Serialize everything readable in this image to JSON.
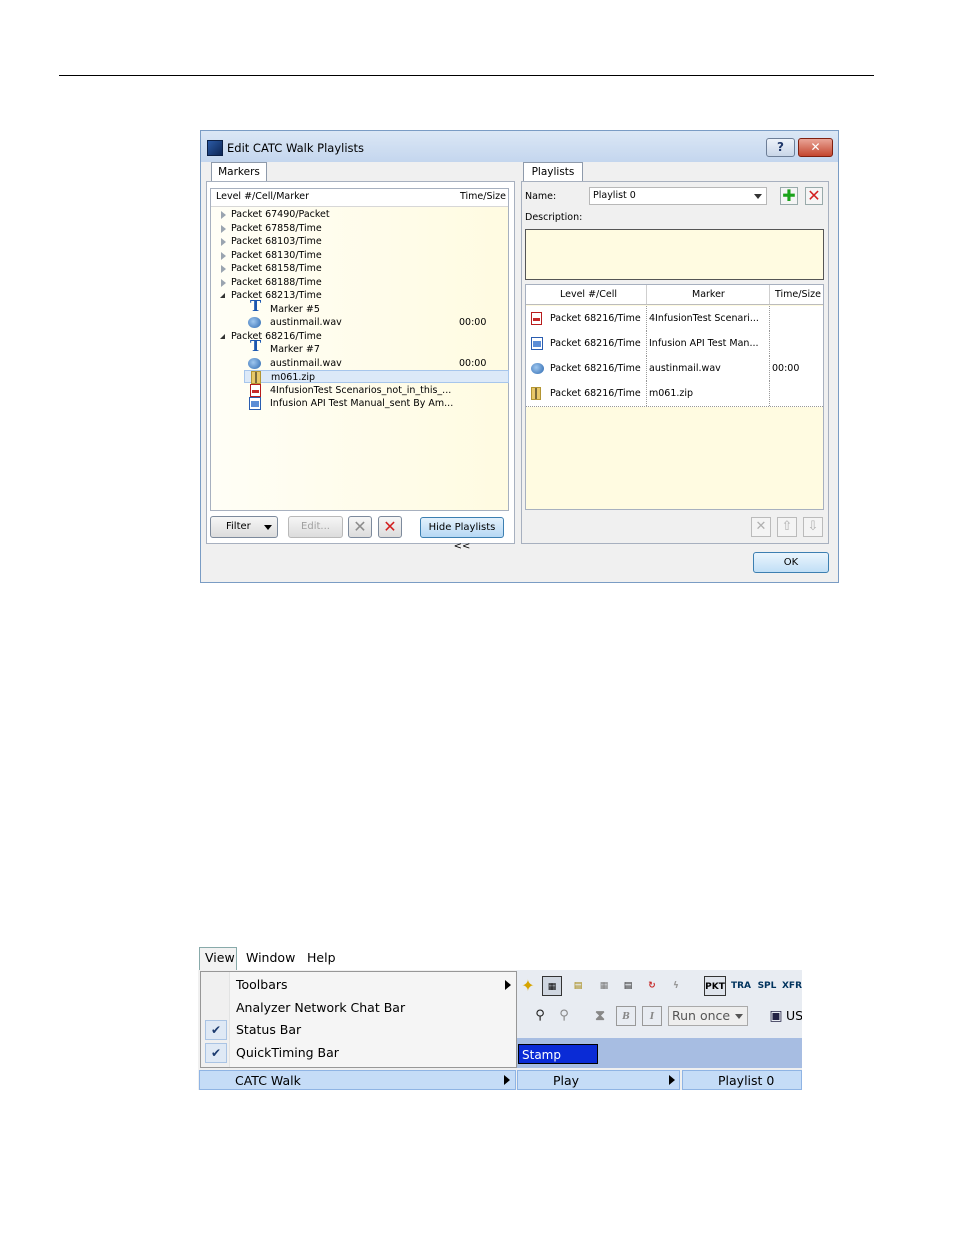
{
  "dialog": {
    "title": "Edit CATC Walk Playlists",
    "help_glyph": "?",
    "close_glyph": "✕",
    "left_tab": "Markers",
    "right_tab": "Playlists",
    "tree_headers": {
      "level": "Level #/Cell/Marker",
      "time": "Time/Size"
    },
    "tree_rows": [
      {
        "label": "Packet 67490/Packet",
        "expander": "closed"
      },
      {
        "label": "Packet 67858/Time",
        "expander": "closed"
      },
      {
        "label": "Packet 68103/Time",
        "expander": "closed"
      },
      {
        "label": "Packet 68130/Time",
        "expander": "closed"
      },
      {
        "label": "Packet 68158/Time",
        "expander": "closed"
      },
      {
        "label": "Packet 68188/Time",
        "expander": "closed"
      },
      {
        "label": "Packet 68213/Time",
        "expander": "open"
      },
      {
        "label": "Marker #5",
        "icon": "text-marker-icon"
      },
      {
        "label": "austinmail.wav",
        "icon": "sound-file-icon",
        "time": "00:00"
      },
      {
        "label": "Packet 68216/Time",
        "expander": "open"
      },
      {
        "label": "Marker #7",
        "icon": "text-marker-icon"
      },
      {
        "label": "austinmail.wav",
        "icon": "sound-file-icon",
        "time": "00:00"
      },
      {
        "label": "m061.zip",
        "icon": "zip-file-icon",
        "selected": true
      },
      {
        "label": "4InfusionTest Scenarios_not_in_this_...",
        "icon": "pdf-file-icon"
      },
      {
        "label": "Infusion API Test Manual_sent By Am...",
        "icon": "doc-file-icon"
      }
    ],
    "buttons": {
      "filter": "Filter",
      "edit": "Edit...",
      "hide_playlists": "Hide Playlists <<",
      "ok": "OK"
    },
    "name_label": "Name:",
    "playlist_name": "Playlist 0",
    "description_label": "Description:",
    "grid_headers": {
      "level": "Level #/Cell",
      "marker": "Marker",
      "time": "Time/Size"
    },
    "grid_rows": [
      {
        "icon": "pdf-file-icon",
        "level": "Packet 68216/Time",
        "marker": "4InfusionTest Scenari...",
        "time": ""
      },
      {
        "icon": "doc-file-icon",
        "level": "Packet 68216/Time",
        "marker": "Infusion API Test Man...",
        "time": ""
      },
      {
        "icon": "sound-file-icon",
        "level": "Packet 68216/Time",
        "marker": "austinmail.wav",
        "time": "00:00"
      },
      {
        "icon": "zip-file-icon",
        "level": "Packet 68216/Time",
        "marker": "m061.zip",
        "time": ""
      }
    ]
  },
  "menu": {
    "bar": [
      "View",
      "Window",
      "Help"
    ],
    "items": [
      {
        "label": "Toolbars",
        "submenu": true,
        "checked": false
      },
      {
        "label": "Analyzer Network Chat Bar",
        "submenu": false,
        "checked": false
      },
      {
        "label": "Status Bar",
        "submenu": false,
        "checked": true
      },
      {
        "label": "QuickTiming Bar",
        "submenu": false,
        "checked": true
      }
    ],
    "catc_walk": "CATC Walk",
    "play": "Play",
    "playlist": "Playlist 0",
    "stamp": "Stamp",
    "run_once": "Run once",
    "toolbar_labels": {
      "pkt": "PKT",
      "tra": "TRA",
      "spl": "SPL",
      "xfr": "XFR",
      "us": "US"
    },
    "check_glyph": "✔"
  },
  "colors": {
    "title_blue": "#c4d6ee",
    "selection_blue": "#c5dcf7",
    "stamp_blue": "#0a2bd6",
    "close_red": "#c4462f"
  }
}
